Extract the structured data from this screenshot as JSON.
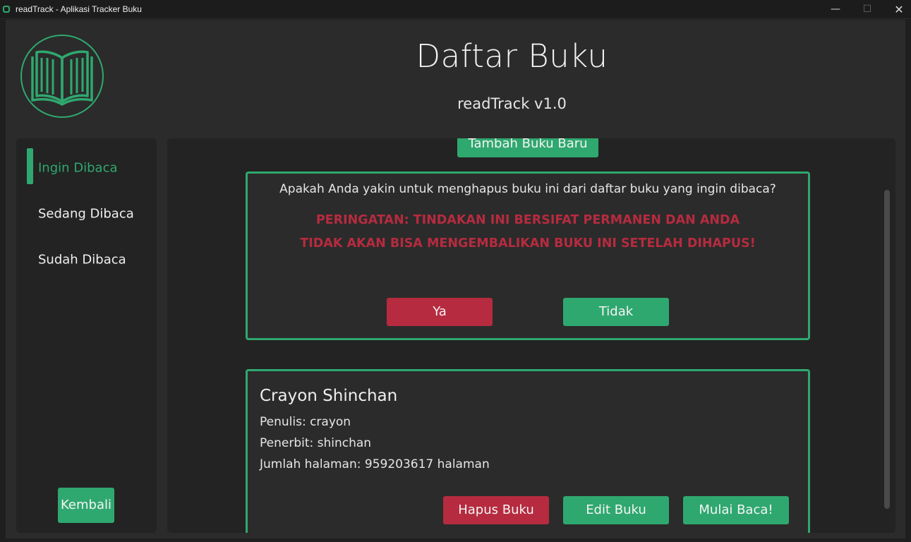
{
  "window": {
    "title": "readTrack - Aplikasi Tracker Buku",
    "minimize_glyph": "—",
    "maximize_glyph": "☐",
    "close_glyph": "✕"
  },
  "header": {
    "title": "Daftar Buku",
    "subtitle": "readTrack v1.0"
  },
  "sidebar": {
    "items": [
      {
        "label": "Ingin Dibaca",
        "active": true
      },
      {
        "label": "Sedang Dibaca",
        "active": false
      },
      {
        "label": "Sudah Dibaca",
        "active": false
      }
    ],
    "back_label": "Kembali"
  },
  "content": {
    "add_button_label": "Tambah Buku Baru",
    "confirm": {
      "question": "Apakah Anda yakin untuk menghapus buku ini dari daftar buku yang ingin dibaca?",
      "warning_line1": "PERINGATAN: TINDAKAN INI BERSIFAT PERMANEN DAN ANDA",
      "warning_line2": "TIDAK AKAN BISA MENGEMBALIKAN BUKU INI SETELAH DIHAPUS!",
      "yes_label": "Ya",
      "no_label": "Tidak"
    },
    "book": {
      "title": "Crayon Shinchan",
      "author": "Penulis: crayon",
      "publisher": "Penerbit: shinchan",
      "pages": "Jumlah halaman: 959203617 halaman",
      "delete_label": "Hapus Buku",
      "edit_label": "Edit Buku",
      "start_label": "Mulai Baca!"
    }
  },
  "colors": {
    "accent": "#2fa86f",
    "danger": "#b62b3f",
    "background": "#2b2b2b",
    "panel": "#232323"
  },
  "icons": {
    "logo": "open-book-icon",
    "app": "app-icon"
  }
}
